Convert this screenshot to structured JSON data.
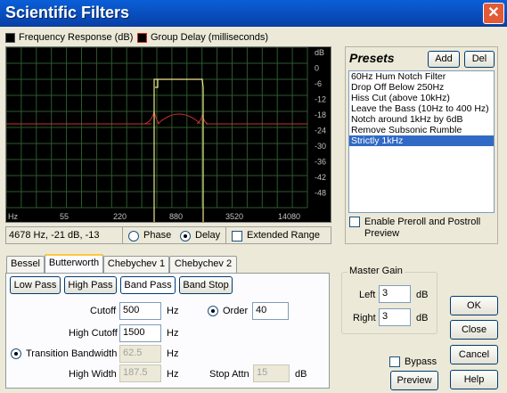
{
  "window": {
    "title": "Scientific Filters"
  },
  "legend": {
    "frequency_response": "Frequency Response (dB)",
    "group_delay": "Group Delay (milliseconds)",
    "fr_color": "#f0e68c",
    "gd_color": "#c8322d"
  },
  "graph": {
    "x_ticks": [
      "Hz",
      "55",
      "220",
      "880",
      "3520",
      "14080"
    ],
    "y_ticks": [
      "dB",
      "0",
      "-6",
      "-12",
      "-18",
      "-24",
      "-30",
      "-36",
      "-42",
      "-48"
    ],
    "readout": "4678 Hz, -21 dB, -13",
    "phase_label": "Phase",
    "delay_label": "Delay",
    "extended_range_label": "Extended Range"
  },
  "presets": {
    "title": "Presets",
    "add_label": "Add",
    "del_label": "Del",
    "items": [
      "60Hz Hum Notch Filter",
      "Drop Off Below 250Hz",
      "Hiss Cut (above 10kHz)",
      "Leave the Bass (10Hz to 400 Hz)",
      "Notch around 1kHz by 6dB",
      "Remove Subsonic Rumble",
      "Strictly 1kHz"
    ],
    "selected_index": 6,
    "preroll_label": "Enable Preroll and Postroll",
    "preroll_label2": "Preview"
  },
  "tabs": [
    "Bessel",
    "Butterworth",
    "Chebychev 1",
    "Chebychev 2"
  ],
  "filter_types": [
    "Low Pass",
    "High Pass",
    "Band Pass",
    "Band Stop"
  ],
  "params": {
    "cutoff_label": "Cutoff",
    "cutoff_value": "500",
    "high_cutoff_label": "High Cutoff",
    "high_cutoff_value": "1500",
    "transition_bw_label": "Transition Bandwidth",
    "transition_bw_value": "62.5",
    "high_width_label": "High Width",
    "high_width_value": "187.5",
    "hz": "Hz",
    "order_label": "Order",
    "order_value": "40",
    "stop_attn_label": "Stop Attn",
    "stop_attn_value": "15",
    "db": "dB"
  },
  "master_gain": {
    "title": "Master Gain",
    "left_label": "Left",
    "left_value": "3",
    "right_label": "Right",
    "right_value": "3",
    "db": "dB"
  },
  "bypass_label": "Bypass",
  "buttons": {
    "preview": "Preview",
    "ok": "OK",
    "close": "Close",
    "cancel": "Cancel",
    "help": "Help"
  }
}
